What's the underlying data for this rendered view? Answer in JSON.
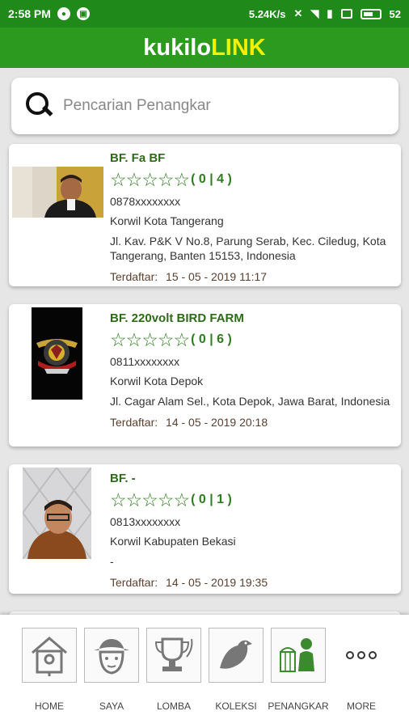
{
  "status_bar": {
    "time": "2:58 PM",
    "net_speed": "5.24K/s",
    "battery": "52"
  },
  "app": {
    "title_part1": "kukilo",
    "title_part2": "LINK",
    "accent_color": "#f3f000",
    "primary_color": "#2c9a1e"
  },
  "search": {
    "placeholder": "Pencarian Penangkar"
  },
  "breeders": [
    {
      "name": "BF. Fa BF",
      "counts": "( 0 | 4 )",
      "stars": 0,
      "phone": "0878xxxxxxxx",
      "region": "Korwil Kota Tangerang",
      "address": "Jl. Kav. P&K V No.8, Parung Serab, Kec. Ciledug, Kota Tangerang, Banten 15153, Indonesia",
      "reg_label": "Terdaftar:",
      "reg_date": "15 - 05 - 2019 11:17",
      "photo": "person-photo"
    },
    {
      "name": "BF. 220volt BIRD FARM",
      "counts": "( 0 | 6 )",
      "stars": 0,
      "phone": "0811xxxxxxxx",
      "region": "Korwil Kota Depok",
      "address": "Jl. Cagar Alam Sel., Kota Depok, Jawa Barat, Indonesia",
      "reg_label": "Terdaftar:",
      "reg_date": "14 - 05 - 2019 20:18",
      "photo": "farm-logo"
    },
    {
      "name": "BF. -",
      "counts": "( 0 | 1 )",
      "stars": 0,
      "phone": "0813xxxxxxxx",
      "region": "Korwil Kabupaten Bekasi",
      "address": "-",
      "reg_label": "Terdaftar:",
      "reg_date": "14 - 05 - 2019 19:35",
      "photo": "person-photo"
    }
  ],
  "bottom_nav": [
    {
      "label": "HOME",
      "icon": "birdhouse-icon"
    },
    {
      "label": "SAYA",
      "icon": "user-hat-icon"
    },
    {
      "label": "LOMBA",
      "icon": "trophy-icon"
    },
    {
      "label": "KOLEKSI",
      "icon": "bird-icon"
    },
    {
      "label": "PENANGKAR",
      "icon": "breeder-icon"
    },
    {
      "label": "MORE",
      "icon": "more-icon"
    }
  ]
}
